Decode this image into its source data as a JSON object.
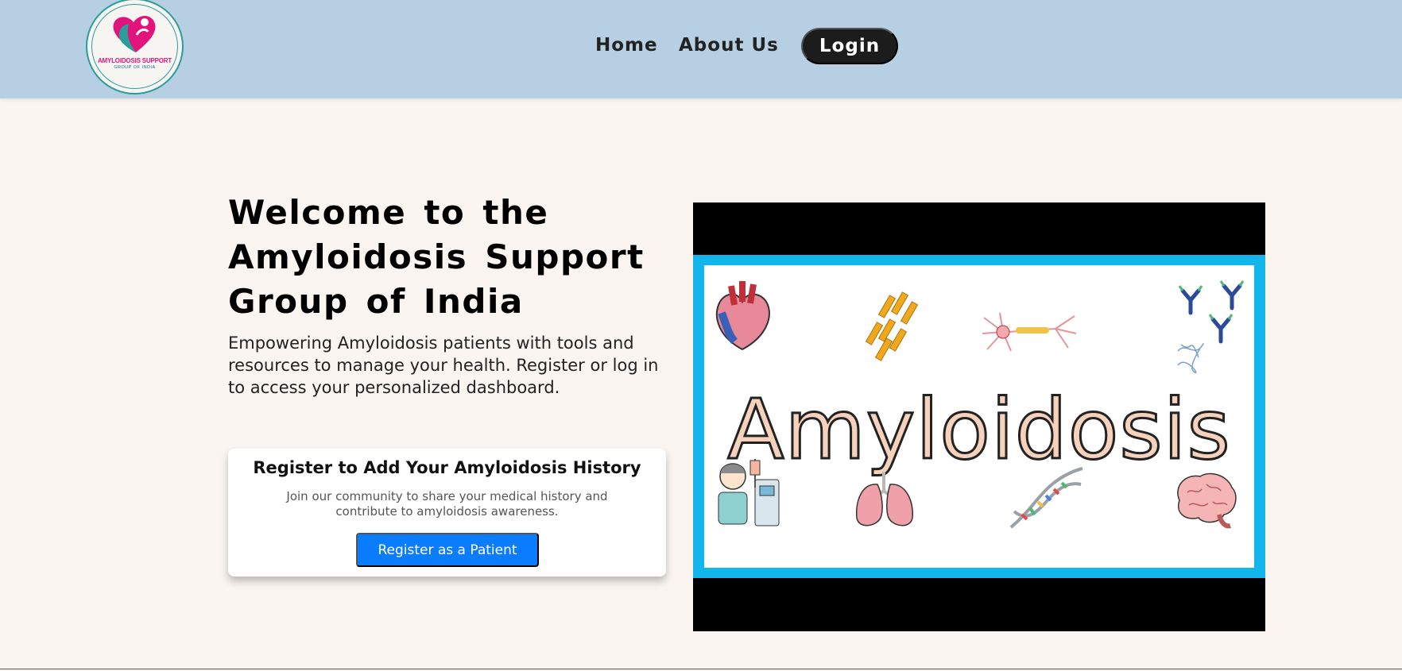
{
  "header": {
    "logo_line1": "AMYLOIDOSIS SUPPORT",
    "logo_line2": "GROUP OF INDIA",
    "nav": {
      "home": "Home",
      "about": "About Us",
      "login": "Login"
    }
  },
  "hero": {
    "title": "Welcome to the Amyloidosis Support Group of India",
    "subtitle": "Empowering Amyloidosis patients with tools and resources to manage your health. Register or log in to access your personalized dashboard."
  },
  "card": {
    "title": "Register to Add Your Amyloidosis History",
    "text": "Join our community to share your medical history and contribute to amyloidosis awareness.",
    "button": "Register as a Patient"
  },
  "video": {
    "word": "Amyloidosis"
  },
  "colors": {
    "header_bg": "#b6cfe2",
    "page_bg": "#faf5f0",
    "login_bg": "#1c1c1c",
    "primary_button": "#0a7cff",
    "frame_blue": "#13b6ea"
  }
}
